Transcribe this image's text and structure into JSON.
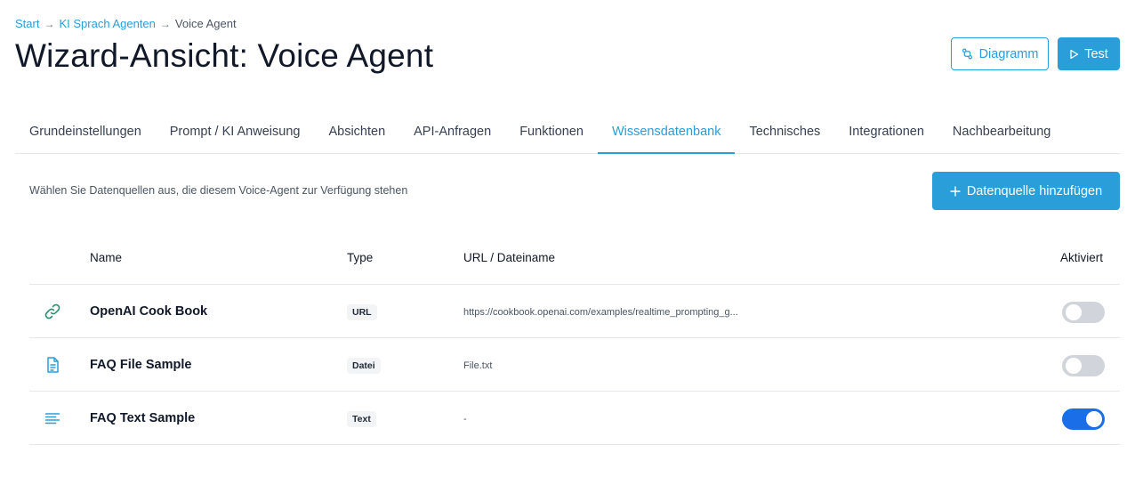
{
  "breadcrumb": {
    "items": [
      "Start",
      "KI Sprach Agenten",
      "Voice Agent"
    ],
    "separator": "→"
  },
  "page": {
    "title": "Wizard-Ansicht: Voice Agent"
  },
  "header_actions": {
    "diagram_label": "Diagramm",
    "test_label": "Test"
  },
  "tabs": [
    {
      "label": "Grundeinstellungen",
      "active": false
    },
    {
      "label": "Prompt / KI Anweisung",
      "active": false
    },
    {
      "label": "Absichten",
      "active": false
    },
    {
      "label": "API-Anfragen",
      "active": false
    },
    {
      "label": "Funktionen",
      "active": false
    },
    {
      "label": "Wissensdatenbank",
      "active": true
    },
    {
      "label": "Technisches",
      "active": false
    },
    {
      "label": "Integrationen",
      "active": false
    },
    {
      "label": "Nachbearbeitung",
      "active": false
    }
  ],
  "knowledge": {
    "description": "Wählen Sie Datenquellen aus, die diesem Voice-Agent zur Verfügung stehen",
    "add_label": "Datenquelle hinzufügen",
    "columns": {
      "name": "Name",
      "type": "Type",
      "url": "URL / Dateiname",
      "active": "Aktiviert"
    },
    "rows": [
      {
        "icon": "link-icon",
        "name": "OpenAI Cook Book",
        "type": "URL",
        "url": "https://cookbook.openai.com/examples/realtime_prompting_g...",
        "active": false
      },
      {
        "icon": "file-icon",
        "name": "FAQ File Sample",
        "type": "Datei",
        "url": "File.txt",
        "active": false
      },
      {
        "icon": "text-lines-icon",
        "name": "FAQ Text Sample",
        "type": "Text",
        "url": "-",
        "active": true
      }
    ]
  },
  "colors": {
    "accent": "#2a9ed8",
    "toggle_on": "#1a6fe8",
    "toggle_off": "#d1d5db"
  }
}
